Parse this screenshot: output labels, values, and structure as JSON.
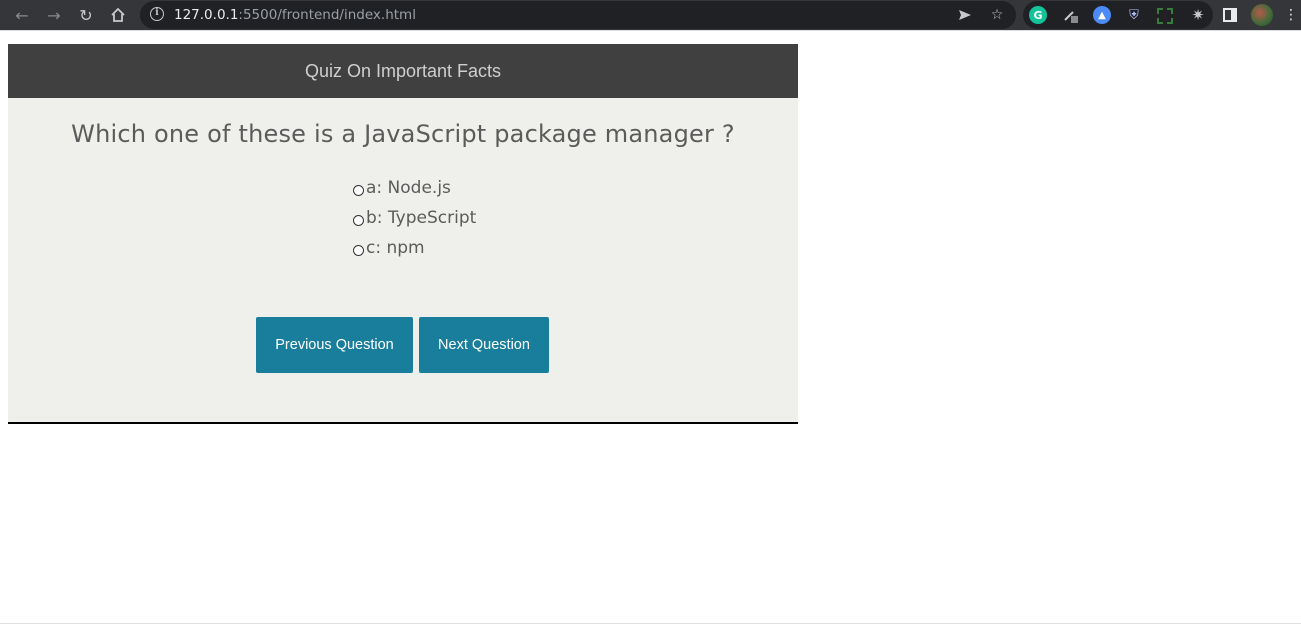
{
  "browser": {
    "url_host": "127.0.0.1",
    "url_rest": ":5500/frontend/index.html",
    "nav_icons": [
      "back-arrow-icon",
      "forward-arrow-icon",
      "reload-icon",
      "home-icon"
    ],
    "omnibox_icons": [
      "send-icon",
      "star-icon"
    ],
    "extensions": [
      "grammarly-icon",
      "eyedropper-icon",
      "blue-extension-icon",
      "shield-extension-icon",
      "screen-capture-icon",
      "puzzle-icon"
    ]
  },
  "quiz": {
    "title": "Quiz On Important Facts",
    "question": "Which one of these is a JavaScript package manager ?",
    "answers": [
      {
        "label": "a: Node.js"
      },
      {
        "label": "b: TypeScript"
      },
      {
        "label": "c: npm"
      }
    ],
    "prev_label": "Previous Question",
    "next_label": "Next Question"
  },
  "colors": {
    "header_bg": "#404040",
    "card_bg": "#eff0eb",
    "button_bg": "#197e9c"
  }
}
